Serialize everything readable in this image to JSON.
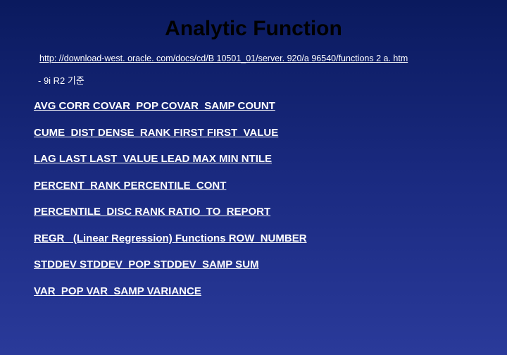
{
  "title": "Analytic Function",
  "url": "http: //download-west. oracle. com/docs/cd/B 10501_01/server. 920/a 96540/functions 2 a. htm",
  "note": " - 9i R2 기준",
  "rows": {
    "r0": "AVG  CORR  COVAR_POP  COVAR_SAMP  COUNT",
    "r1": "CUME_DIST DENSE_RANK FIRST FIRST_VALUE",
    "r2": "LAG LAST LAST_VALUE  LEAD MAX  MIN  NTILE",
    "r3": "PERCENT_RANK PERCENTILE_CONT",
    "r4": "PERCENTILE_DISC RANK RATIO_TO_REPORT",
    "r5": "REGR_ (Linear Regression) Functions  ROW_NUMBER",
    "r6": "STDDEV  STDDEV_POP  STDDEV_SAMP SUM",
    "r7": "VAR_POP  VAR_SAMP  VARIANCE"
  }
}
